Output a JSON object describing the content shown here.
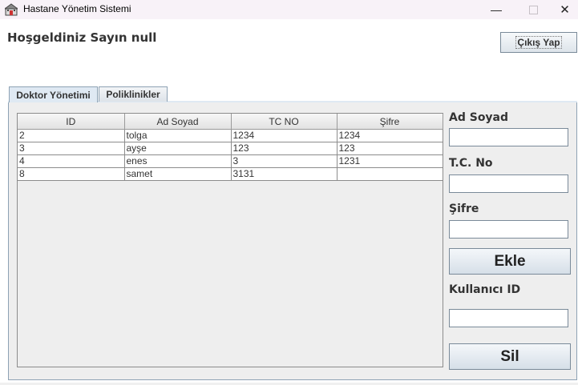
{
  "window": {
    "title": "Hastane Yönetim Sistemi",
    "minimize_glyph": "—",
    "close_glyph": "✕"
  },
  "header": {
    "welcome": "Hoşgeldiniz Sayın null",
    "logout_label": "Çıkış Yap"
  },
  "tabs": [
    {
      "label": "Doktor Yönetimi",
      "active": true
    },
    {
      "label": "Poliklinikler",
      "active": false
    }
  ],
  "table": {
    "columns": [
      "ID",
      "Ad Soyad",
      "TC NO",
      "Şifre"
    ],
    "rows": [
      [
        "2",
        "tolga",
        "1234",
        "1234"
      ],
      [
        "3",
        "ayşe",
        "123",
        "123"
      ],
      [
        "4",
        "enes",
        "3",
        "1231"
      ],
      [
        "8",
        "samet",
        "3131",
        ""
      ]
    ]
  },
  "form": {
    "name_label": "Ad Soyad",
    "name_value": "",
    "tc_label": "T.C. No",
    "tc_value": "",
    "password_label": "Şifre",
    "password_value": "",
    "add_label": "Ekle",
    "user_id_label": "Kullanıcı ID",
    "user_id_value": "",
    "delete_label": "Sil"
  },
  "icons": {
    "app": "hospital-app-icon",
    "minimize": "minimize-icon",
    "maximize": "maximize-icon",
    "close": "close-icon"
  },
  "colors": {
    "tab_active": "#dfe9f3",
    "border": "#8ea2b4",
    "panel_bg": "#eeeeee"
  }
}
